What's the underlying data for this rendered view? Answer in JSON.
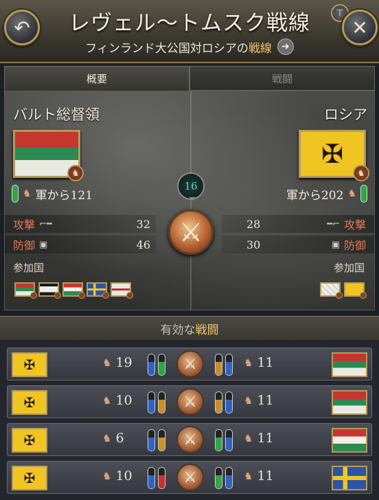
{
  "header": {
    "title": "レヴェル〜トムスク戦線",
    "subtitle_prefix": "フィンランド大公国対ロシアの",
    "subtitle_highlight": "戦線",
    "back_glyph": "↶",
    "close_glyph": "✕",
    "arrow_glyph": "➜",
    "pin_glyph": "📌"
  },
  "tabs": [
    {
      "label": "概要",
      "active": true
    },
    {
      "label": "戦闘",
      "active": false
    }
  ],
  "overview": {
    "warscore": "16",
    "left": {
      "name": "バルト総督領",
      "army_label": "軍から121",
      "attack_label": "攻撃",
      "attack_value": "32",
      "defense_label": "防御",
      "defense_value": "46",
      "participants_label": "参加国"
    },
    "right": {
      "name": "ロシア",
      "army_label": "軍から202",
      "attack_label": "攻撃",
      "attack_value": "28",
      "defense_label": "防御",
      "defense_value": "30",
      "participants_label": "参加国"
    }
  },
  "battles": {
    "header_prefix": "有効な",
    "header_highlight": "戦闘",
    "rows": [
      {
        "left_value": "19",
        "right_value": "11",
        "left_bar_colors": [
          "#2e63c4",
          "#2fa745"
        ],
        "right_bar_colors": [
          "#c8902a",
          "#2e63c4"
        ],
        "right_flag": "tricolor"
      },
      {
        "left_value": "10",
        "right_value": "11",
        "left_bar_colors": [
          "#2e63c4",
          "#c8902a"
        ],
        "right_bar_colors": [
          "#c8902a",
          "#2e63c4"
        ],
        "right_flag": "tricolor"
      },
      {
        "left_value": "6",
        "right_value": "11",
        "left_bar_colors": [
          "#2e63c4",
          "#c8902a"
        ],
        "right_bar_colors": [
          "#2fa745",
          "#2e63c4"
        ],
        "right_flag": "hungary"
      },
      {
        "left_value": "10",
        "right_value": "11",
        "left_bar_colors": [
          "#2e63c4",
          "#c7312b"
        ],
        "right_bar_colors": [
          "#2fa745",
          "#2e63c4"
        ],
        "right_flag": "swe"
      }
    ]
  },
  "icons": {
    "eagle": "✠",
    "swords": "⚔",
    "soldier": "♞",
    "gun": "⌐",
    "shield": "▣"
  }
}
